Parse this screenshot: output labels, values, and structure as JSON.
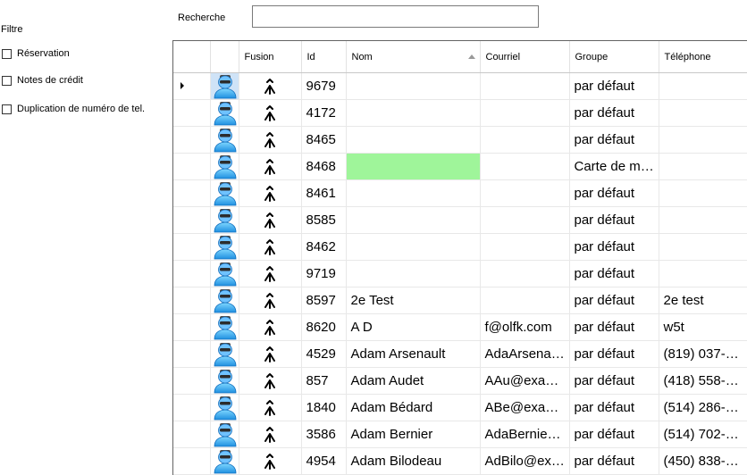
{
  "filter": {
    "title": "Filtre",
    "options": [
      {
        "label": "Réservation",
        "checked": false
      },
      {
        "label": "Notes de crédit",
        "checked": false
      },
      {
        "label": "Duplication de numéro de tel.",
        "checked": false
      }
    ]
  },
  "search": {
    "label": "Recherche",
    "value": ""
  },
  "grid": {
    "columns": {
      "fusion": "Fusion",
      "id": "Id",
      "nom": "Nom",
      "courriel": "Courriel",
      "groupe": "Groupe",
      "telephone": "Téléphone"
    },
    "sort_column": "Nom",
    "sort_direction": "ascending",
    "rows": [
      {
        "id": "9679",
        "nom": "",
        "courriel": "",
        "groupe": "par défaut",
        "telephone": ""
      },
      {
        "id": "4172",
        "nom": "",
        "courriel": "",
        "groupe": "par défaut",
        "telephone": ""
      },
      {
        "id": "8465",
        "nom": "",
        "courriel": "",
        "groupe": "par défaut",
        "telephone": ""
      },
      {
        "id": "8468",
        "nom": "",
        "courriel": "",
        "groupe": "Carte de m…",
        "telephone": ""
      },
      {
        "id": "8461",
        "nom": "",
        "courriel": "",
        "groupe": "par défaut",
        "telephone": ""
      },
      {
        "id": "8585",
        "nom": "",
        "courriel": "",
        "groupe": "par défaut",
        "telephone": ""
      },
      {
        "id": "8462",
        "nom": "",
        "courriel": "",
        "groupe": "par défaut",
        "telephone": ""
      },
      {
        "id": "9719",
        "nom": "",
        "courriel": "",
        "groupe": "par défaut",
        "telephone": ""
      },
      {
        "id": "8597",
        "nom": "2e Test",
        "courriel": "",
        "groupe": "par défaut",
        "telephone": "2e test"
      },
      {
        "id": "8620",
        "nom": "A D",
        "courriel": "f@olfk.com",
        "groupe": "par défaut",
        "telephone": "w5t"
      },
      {
        "id": "4529",
        "nom": "Adam Arsenault",
        "courriel": "AdaArsena…",
        "groupe": "par défaut",
        "telephone": "(819) 037-…"
      },
      {
        "id": "857",
        "nom": "Adam Audet",
        "courriel": "AAu@exa…",
        "groupe": "par défaut",
        "telephone": "(418) 558-…"
      },
      {
        "id": "1840",
        "nom": "Adam Bédard",
        "courriel": "ABe@exam…",
        "groupe": "par défaut",
        "telephone": "(514) 286-…"
      },
      {
        "id": "3586",
        "nom": "Adam Bernier",
        "courriel": "AdaBernie…",
        "groupe": "par défaut",
        "telephone": "(514) 702-…"
      },
      {
        "id": "4954",
        "nom": "Adam Bilodeau",
        "courriel": "AdBilo@ex…",
        "groupe": "par défaut",
        "telephone": "(450) 838-…"
      }
    ]
  },
  "colors": {
    "highlight_nom": "#9ff59a",
    "selected_avatar": "#cfe3f7"
  },
  "icons": {
    "avatar": "user-avatar-icon",
    "fusion": "merge-icon",
    "row_indicator": "current-row-arrow-icon"
  }
}
